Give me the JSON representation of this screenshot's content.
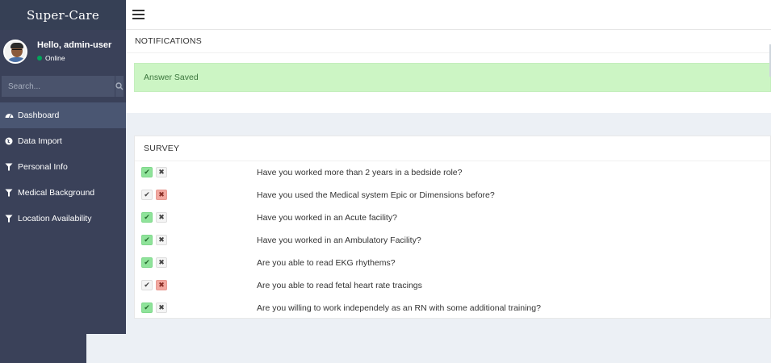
{
  "app": {
    "brand": "Super-Care"
  },
  "user": {
    "greeting": "Hello, admin-user",
    "status": "Online"
  },
  "search": {
    "placeholder": "Search..."
  },
  "sidebar": {
    "items": [
      {
        "label": "Dashboard",
        "icon": "dashboard-icon",
        "active": true
      },
      {
        "label": "Data Import",
        "icon": "globe-icon"
      },
      {
        "label": "Personal Info",
        "icon": "filter-icon"
      },
      {
        "label": "Medical Background",
        "icon": "filter-icon"
      },
      {
        "label": "Location Availability",
        "icon": "filter-icon"
      }
    ]
  },
  "notifications": {
    "title": "NOTIFICATIONS",
    "message": "Answer Saved"
  },
  "survey": {
    "title": "SURVEY",
    "questions": [
      {
        "text": "Have you worked more than 2 years in a bedside role?",
        "answer": "yes"
      },
      {
        "text": "Have you used the Medical system Epic or Dimensions before?",
        "answer": "no"
      },
      {
        "text": "Have you worked in an Acute facility?",
        "answer": "yes"
      },
      {
        "text": "Have you worked in an Ambulatory Facility?",
        "answer": "yes"
      },
      {
        "text": "Are you able to read EKG rhythems?",
        "answer": "yes"
      },
      {
        "text": "Are you able to read fetal heart rate tracings",
        "answer": "no"
      },
      {
        "text": "Are you willing to work independely as an RN with some additional training?",
        "answer": "yes"
      }
    ]
  },
  "colors": {
    "sidebar": "#3a4159",
    "success_bg": "#ccf5c4",
    "yes": "#8fe39a",
    "no": "#f2a8a0"
  }
}
